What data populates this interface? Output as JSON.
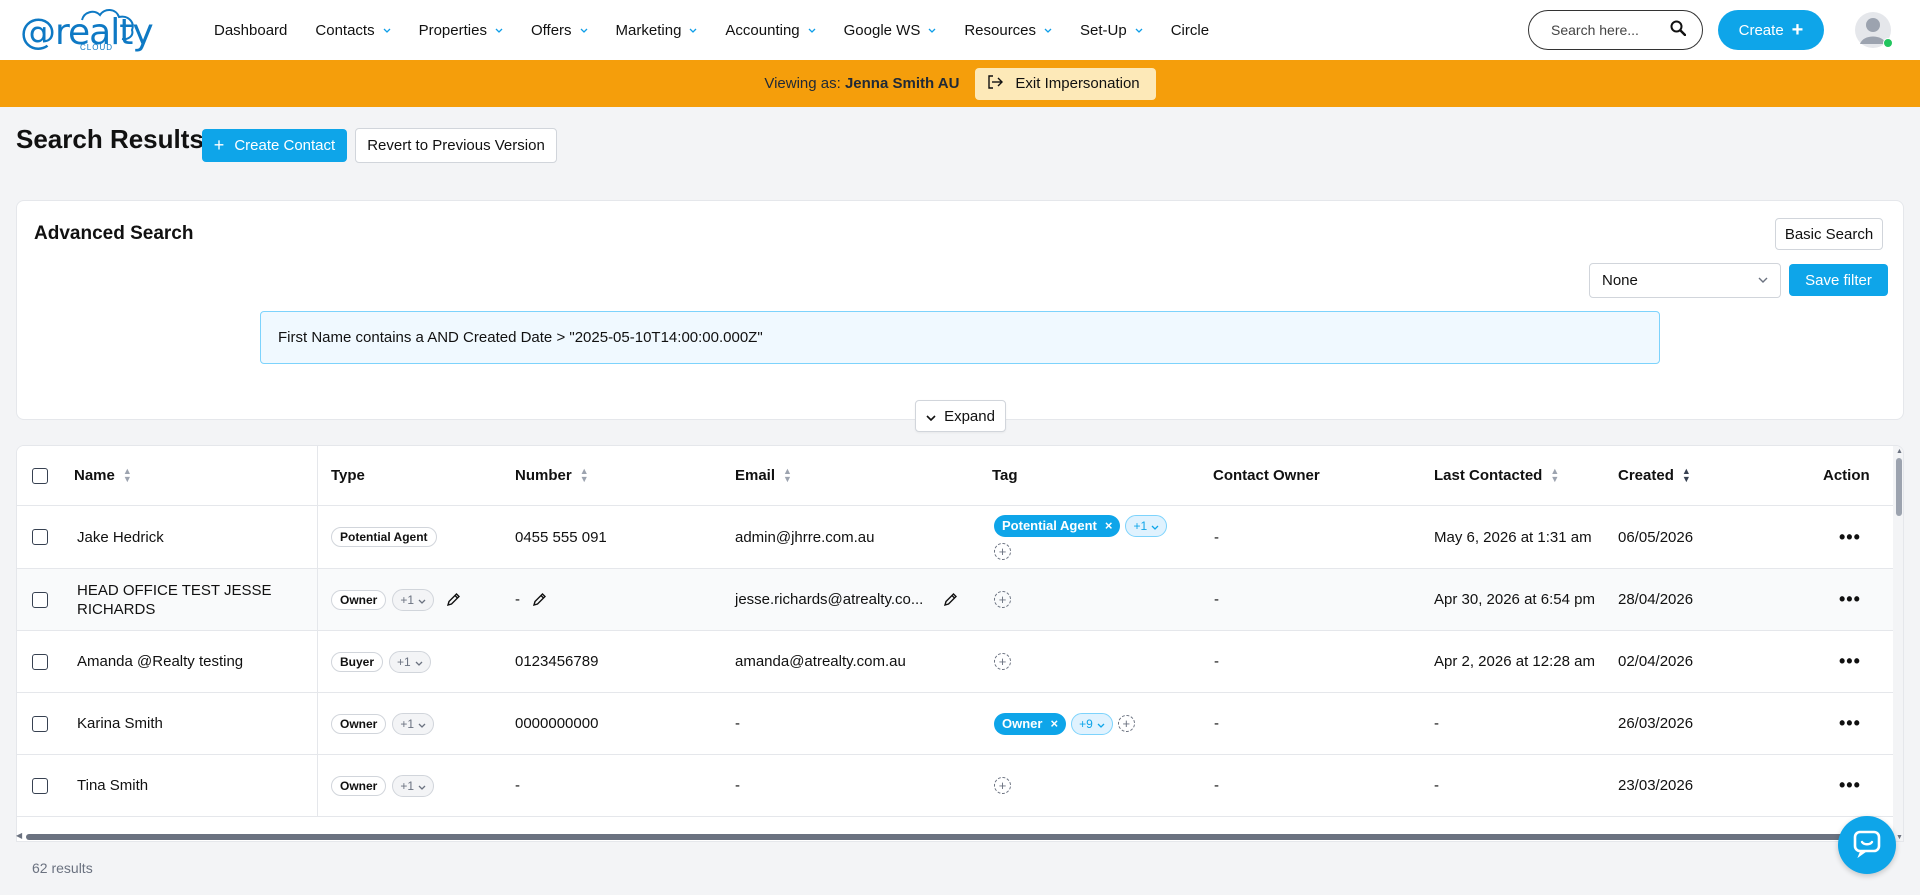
{
  "logo": {
    "text": "@realty",
    "sub": "CLOUD"
  },
  "nav": {
    "items": [
      {
        "label": "Dashboard",
        "dropdown": false
      },
      {
        "label": "Contacts",
        "dropdown": true
      },
      {
        "label": "Properties",
        "dropdown": true
      },
      {
        "label": "Offers",
        "dropdown": true
      },
      {
        "label": "Marketing",
        "dropdown": true
      },
      {
        "label": "Accounting",
        "dropdown": true
      },
      {
        "label": "Google WS",
        "dropdown": true
      },
      {
        "label": "Resources",
        "dropdown": true
      },
      {
        "label": "Set-Up",
        "dropdown": true
      },
      {
        "label": "Circle",
        "dropdown": false
      }
    ],
    "search_placeholder": "Search here...",
    "create_label": "Create"
  },
  "impersonation": {
    "prefix": "Viewing as:",
    "user": "Jenna Smith AU",
    "exit_label": "Exit Impersonation"
  },
  "page": {
    "title": "Search Results",
    "create_contact_label": "Create Contact",
    "revert_label": "Revert to Previous Version"
  },
  "advanced_search": {
    "title": "Advanced Search",
    "basic_search_label": "Basic Search",
    "filter_selected": "None",
    "save_filter_label": "Save filter",
    "query": "First Name contains a AND Created Date > \"2025-05-10T14:00:00.000Z\"",
    "expand_label": "Expand"
  },
  "table": {
    "headers": {
      "name": "Name",
      "type": "Type",
      "number": "Number",
      "email": "Email",
      "tag": "Tag",
      "owner": "Contact Owner",
      "last_contacted": "Last Contacted",
      "created": "Created",
      "action": "Action"
    },
    "rows": [
      {
        "name": "Jake Hedrick",
        "type": "Potential Agent",
        "type_more": "",
        "number": "0455 555 091",
        "email": "admin@jhrre.com.au",
        "tag": "Potential Agent",
        "tag_more": "+1",
        "owner": "-",
        "last_contacted": "May 6, 2026 at 1:31 am",
        "created": "06/05/2026"
      },
      {
        "name": "HEAD OFFICE TEST JESSE RICHARDS",
        "type": "Owner",
        "type_more": "+1",
        "number": "-",
        "email": "jesse.richards@atrealty.co...",
        "tag": "",
        "tag_more": "",
        "owner": "-",
        "last_contacted": "Apr 30, 2026 at 6:54 pm",
        "created": "28/04/2026"
      },
      {
        "name": "Amanda @Realty testing",
        "type": "Buyer",
        "type_more": "+1",
        "number": "0123456789",
        "email": "amanda@atrealty.com.au",
        "tag": "",
        "tag_more": "",
        "owner": "-",
        "last_contacted": "Apr 2, 2026 at 12:28 am",
        "created": "02/04/2026"
      },
      {
        "name": "Karina Smith",
        "type": "Owner",
        "type_more": "+1",
        "number": "0000000000",
        "email": "-",
        "tag": "Owner",
        "tag_more": "+9",
        "owner": "-",
        "last_contacted": "-",
        "created": "26/03/2026"
      },
      {
        "name": "Tina Smith",
        "type": "Owner",
        "type_more": "+1",
        "number": "-",
        "email": "-",
        "tag": "",
        "tag_more": "",
        "owner": "-",
        "last_contacted": "-",
        "created": "23/03/2026"
      }
    ],
    "action_glyph": "•••",
    "results_count": "62 results"
  },
  "colors": {
    "accent": "#0ea5e9",
    "impersonation_bar": "#f59e0b",
    "logo": "#0e79c4"
  }
}
